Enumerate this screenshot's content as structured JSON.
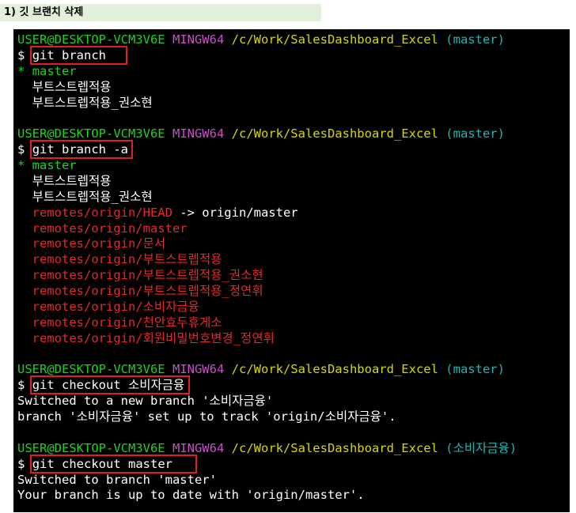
{
  "heading": "1) 깃 브랜치 삭제",
  "prompt": {
    "user": "USER@DESKTOP-VCM3V6E",
    "env": "MINGW64",
    "path": "/c/Work/SalesDashboard_Excel",
    "branch_master": "(master)",
    "branch_new": "(소비자금융)",
    "symbol": "$"
  },
  "blocks": [
    {
      "command": "git branch",
      "output": [
        {
          "text": "* master",
          "color": "green"
        },
        {
          "text": "  부트스트렙적용",
          "color": "white"
        },
        {
          "text": "  부트스트렙적용_권소현",
          "color": "white"
        }
      ]
    },
    {
      "command": "git branch -a",
      "output": [
        {
          "text": "* master",
          "color": "green"
        },
        {
          "text": "  부트스트렙적용",
          "color": "white"
        },
        {
          "text": "  부트스트렙적용_권소현",
          "color": "white"
        },
        {
          "text": "  remotes/origin/HEAD",
          "suffix": " -> origin/master",
          "color": "red"
        },
        {
          "text": "  remotes/origin/master",
          "color": "red"
        },
        {
          "text": "  remotes/origin/문서",
          "color": "red"
        },
        {
          "text": "  remotes/origin/부트스트렙적용",
          "color": "red"
        },
        {
          "text": "  remotes/origin/부트스트렙적용_권소현",
          "color": "red"
        },
        {
          "text": "  remotes/origin/부트스트렙적용_정연휘",
          "color": "red"
        },
        {
          "text": "  remotes/origin/소비자금융",
          "color": "red"
        },
        {
          "text": "  remotes/origin/천안효두휴게소",
          "color": "red"
        },
        {
          "text": "  remotes/origin/회원비밀번호변경_정연휘",
          "color": "red"
        }
      ]
    },
    {
      "command": "git checkout 소비자금융",
      "output": [
        {
          "text": "Switched to a new branch '소비자금융'",
          "color": "white"
        },
        {
          "text": "branch '소비자금융' set up to track 'origin/소비자금융'.",
          "color": "white"
        }
      ]
    },
    {
      "command": "git checkout master",
      "output": [
        {
          "text": "Switched to branch 'master'",
          "color": "white"
        },
        {
          "text": "Your branch is up to date with 'origin/master'.",
          "color": "white"
        }
      ]
    }
  ],
  "colors": {
    "green": "#1fd21f",
    "magenta": "#c850c8",
    "yellow": "#d7d700",
    "cyan": "#1fb4b4",
    "red": "#e62828",
    "white": "#ffffff",
    "highlight_box": "#e02020",
    "heading_bg": "#e2efda"
  }
}
